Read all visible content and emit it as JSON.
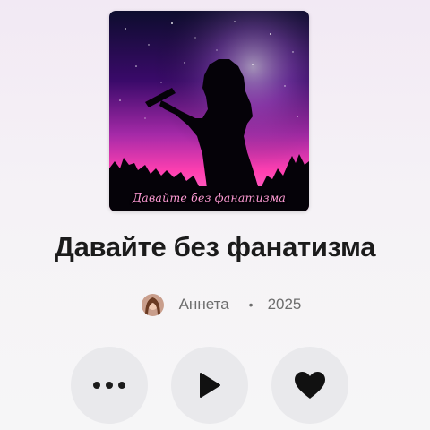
{
  "album": {
    "cover_caption": "Давайте без фанатизма",
    "title": "Давайте без фанатизма",
    "artist": "Аннета",
    "separator": "•",
    "year": "2025"
  },
  "actions": {
    "more_icon": "more-dots-icon",
    "play_icon": "play-icon",
    "like_icon": "heart-icon"
  },
  "colors": {
    "cover_purple": "#3a0a6a",
    "cover_pink": "#ff3fb0",
    "title_text": "#1b1b1b",
    "meta_text": "#6d6d6d",
    "button_bg": "#e9e9ec"
  }
}
